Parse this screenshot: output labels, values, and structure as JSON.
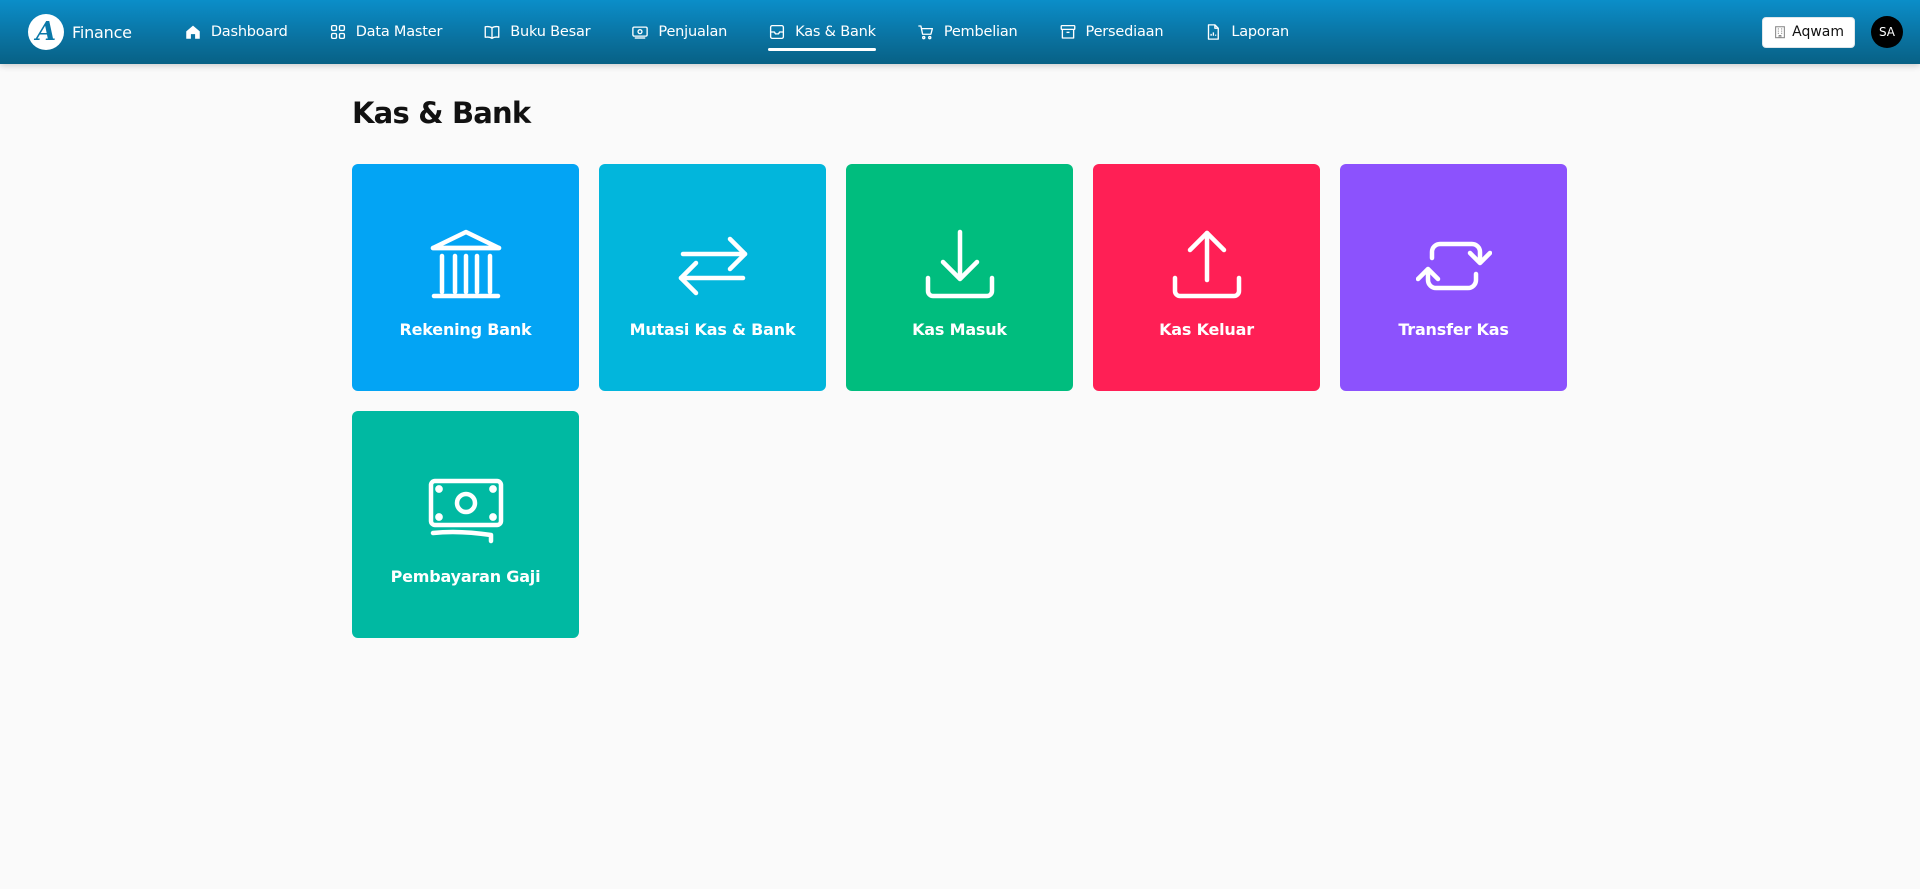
{
  "app": {
    "logo_letter": "A",
    "name": "Finance"
  },
  "nav": {
    "items": [
      {
        "label": "Dashboard",
        "icon": "home-icon"
      },
      {
        "label": "Data Master",
        "icon": "grid-icon"
      },
      {
        "label": "Buku Besar",
        "icon": "book-icon"
      },
      {
        "label": "Penjualan",
        "icon": "cash-icon"
      },
      {
        "label": "Kas & Bank",
        "icon": "inbox-icon",
        "active": true
      },
      {
        "label": "Pembelian",
        "icon": "cart-icon"
      },
      {
        "label": "Persediaan",
        "icon": "archive-icon"
      },
      {
        "label": "Laporan",
        "icon": "document-icon"
      }
    ]
  },
  "header": {
    "company_label": "Aqwam",
    "avatar_initials": "SA"
  },
  "main": {
    "title": "Kas & Bank",
    "cards": [
      {
        "label": "Rekening Bank",
        "icon": "bank-icon",
        "color": "#03a4f4"
      },
      {
        "label": "Mutasi Kas & Bank",
        "icon": "arrows-switch-icon",
        "color": "#02b6dc"
      },
      {
        "label": "Kas Masuk",
        "icon": "download-icon",
        "color": "#00bd7e"
      },
      {
        "label": "Kas Keluar",
        "icon": "upload-icon",
        "color": "#ff1f55"
      },
      {
        "label": "Transfer Kas",
        "icon": "refresh-icon",
        "color": "#8c52fd"
      },
      {
        "label": "Pembayaran Gaji",
        "icon": "money-icon",
        "color": "#00b9a2"
      }
    ]
  },
  "colors": {
    "header_gradient_top": "#0b8ec9",
    "header_gradient_bottom": "#086185",
    "page_background": "#fafafa"
  }
}
